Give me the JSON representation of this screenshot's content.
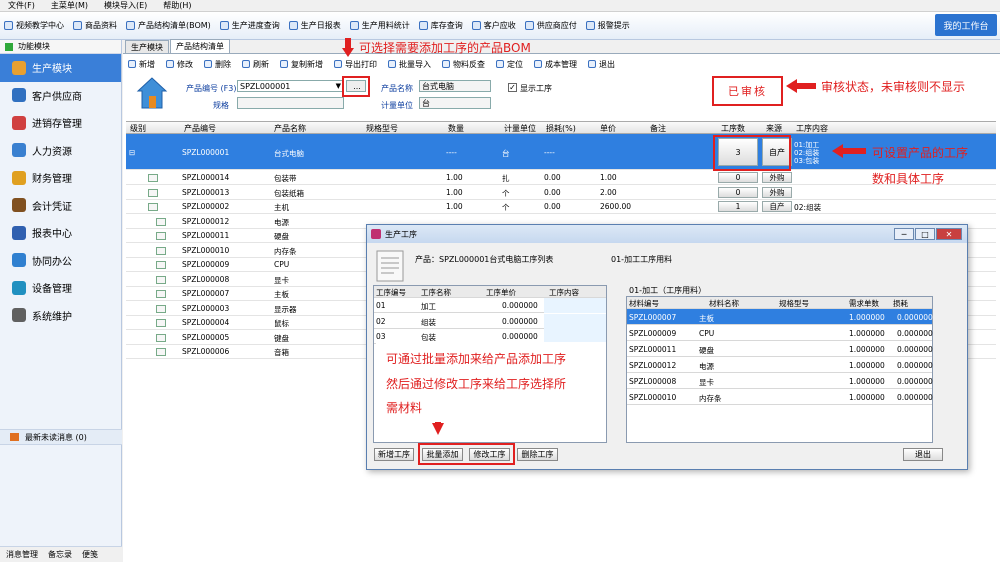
{
  "menu": [
    "文件(F)",
    "主菜单(M)",
    "模块导入(E)",
    "帮助(H)"
  ],
  "toolbar": [
    "视频教学中心",
    "商品资料",
    "产品结构清单(BOM)",
    "生产进度查询",
    "生产日报表",
    "生产用料统计",
    "库存查询",
    "客户应收",
    "供应商应付",
    "报警提示"
  ],
  "workbench": "我的工作台",
  "sidebar": {
    "header": "功能模块",
    "items": [
      "生产模块",
      "客户供应商",
      "进销存管理",
      "人力资源",
      "财务管理",
      "会计凭证",
      "报表中心",
      "协同办公",
      "设备管理",
      "系统维护"
    ],
    "unread": "最新未读消息 (0)",
    "footer": [
      "消息管理",
      "备忘录",
      "便笺"
    ]
  },
  "tabs": [
    "生产模块",
    "产品结构清单"
  ],
  "subtools": [
    "新增",
    "修改",
    "删除",
    "刷新",
    "复制新增",
    "导出打印",
    "批量导入",
    "物料反查",
    "定位",
    "成本管理",
    "退出"
  ],
  "form": {
    "code_label": "产品编号 (F3)",
    "code_value": "SPZL000001",
    "browse": "...",
    "spec_label": "规格",
    "name_label": "产品名称",
    "name_value": "台式电脑",
    "unit_label": "计量单位",
    "unit_value": "台",
    "show_process": "显示工序"
  },
  "audit": "已审核",
  "notes": {
    "bom": "可选择需要添加工序的产品BOM",
    "audit": "审核状态，未审核则不显示",
    "process1": "可设置产品的工序",
    "process2": "数和具体工序",
    "batch1": "可通过批量添加来给产品添加工序",
    "batch2": "然后通过修改工序来给工序选择所",
    "batch3": "需材料"
  },
  "grid": {
    "headers": [
      "级别",
      "产品编号",
      "产品名称",
      "规格型号",
      "数量",
      "计量单位",
      "损耗(%)",
      "单价",
      "备注",
      "工序数",
      "来源",
      "工序内容"
    ],
    "selected": {
      "code": "SPZL000001",
      "name": "台式电脑",
      "qty": "----",
      "unit": "台",
      "loss": "----",
      "count": "3",
      "source": "自产",
      "content": [
        "01:加工",
        "02:组装",
        "03:包装"
      ]
    },
    "rows": [
      {
        "code": "SPZL000014",
        "name": "包装带",
        "qty": "1.00",
        "unit": "扎",
        "loss": "0.00",
        "price": "1.00",
        "count": "0",
        "source": "外购",
        "content": ""
      },
      {
        "code": "SPZL000013",
        "name": "包装纸箱",
        "qty": "1.00",
        "unit": "个",
        "loss": "0.00",
        "price": "2.00",
        "count": "0",
        "source": "外购",
        "content": ""
      },
      {
        "code": "SPZL000002",
        "name": "主机",
        "qty": "1.00",
        "unit": "个",
        "loss": "0.00",
        "price": "2600.00",
        "count": "1",
        "source": "自产",
        "content": "02:组装"
      },
      {
        "code": "SPZL000012",
        "name": "电源",
        "qty": "",
        "unit": "",
        "loss": "",
        "price": "",
        "count": "",
        "source": "",
        "content": ""
      },
      {
        "code": "SPZL000011",
        "name": "硬盘",
        "qty": "",
        "unit": "",
        "loss": "",
        "price": "",
        "count": "",
        "source": "",
        "content": ""
      },
      {
        "code": "SPZL000010",
        "name": "内存条",
        "qty": "",
        "unit": "",
        "loss": "",
        "price": "",
        "count": "",
        "source": "",
        "content": ""
      },
      {
        "code": "SPZL000009",
        "name": "CPU",
        "qty": "",
        "unit": "",
        "loss": "",
        "price": "",
        "count": "",
        "source": "",
        "content": ""
      },
      {
        "code": "SPZL000008",
        "name": "显卡",
        "qty": "",
        "unit": "",
        "loss": "",
        "price": "",
        "count": "",
        "source": "",
        "content": ""
      },
      {
        "code": "SPZL000007",
        "name": "主板",
        "qty": "",
        "unit": "",
        "loss": "",
        "price": "",
        "count": "",
        "source": "",
        "content": ""
      },
      {
        "code": "SPZL000003",
        "name": "显示器",
        "qty": "",
        "unit": "",
        "loss": "",
        "price": "",
        "count": "",
        "source": "",
        "content": ""
      },
      {
        "code": "SPZL000004",
        "name": "鼠标",
        "qty": "",
        "unit": "",
        "loss": "",
        "price": "",
        "count": "",
        "source": "",
        "content": ""
      },
      {
        "code": "SPZL000005",
        "name": "键盘",
        "qty": "",
        "unit": "",
        "loss": "",
        "price": "",
        "count": "",
        "source": "",
        "content": ""
      },
      {
        "code": "SPZL000006",
        "name": "音箱",
        "qty": "",
        "unit": "",
        "loss": "",
        "price": "",
        "count": "",
        "source": "",
        "content": ""
      }
    ]
  },
  "dialog": {
    "title": "生产工序",
    "product": "产品：SPZL000001台式电脑工序列表",
    "process_label": "01-加工工序用料",
    "material_caption": "01-加工（工序用料）",
    "proc_headers": [
      "工序编号",
      "工序名称",
      "工序单价",
      "工序内容"
    ],
    "procs": [
      {
        "no": "01",
        "name": "加工",
        "price": "0.000000"
      },
      {
        "no": "02",
        "name": "组装",
        "price": "0.000000"
      },
      {
        "no": "03",
        "name": "包装",
        "price": "0.000000"
      }
    ],
    "mat_headers": [
      "材料编号",
      "材料名称",
      "规格型号",
      "需求单数",
      "损耗"
    ],
    "mats": [
      {
        "no": "SPZL000007",
        "name": "主板",
        "qty": "1.000000",
        "loss": "0.000000"
      },
      {
        "no": "SPZL000009",
        "name": "CPU",
        "qty": "1.000000",
        "loss": "0.000000"
      },
      {
        "no": "SPZL000011",
        "name": "硬盘",
        "qty": "1.000000",
        "loss": "0.000000"
      },
      {
        "no": "SPZL000012",
        "name": "电源",
        "qty": "1.000000",
        "loss": "0.000000"
      },
      {
        "no": "SPZL000008",
        "name": "显卡",
        "qty": "1.000000",
        "loss": "0.000000"
      },
      {
        "no": "SPZL000010",
        "name": "内存条",
        "qty": "1.000000",
        "loss": "0.000000"
      }
    ],
    "buttons": [
      "新增工序",
      "批量添加",
      "修改工序",
      "删除工序"
    ],
    "exit": "退出"
  }
}
